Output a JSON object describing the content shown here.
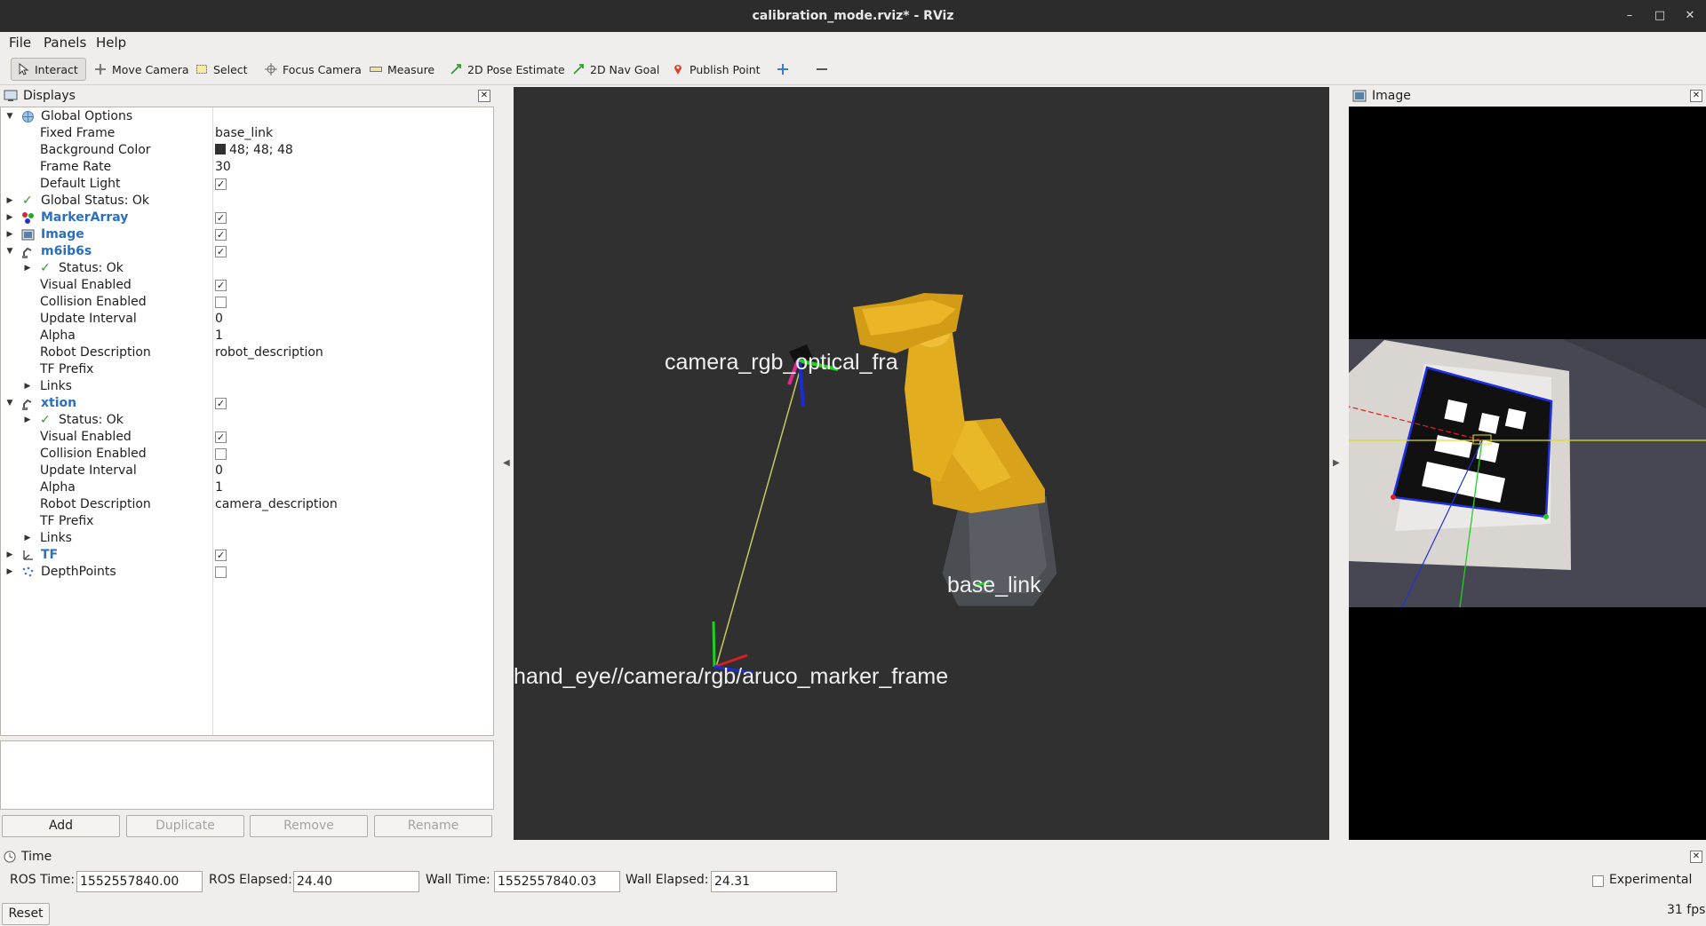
{
  "window": {
    "title": "calibration_mode.rviz* - RViz"
  },
  "menu": [
    "File",
    "Panels",
    "Help"
  ],
  "toolbar": {
    "interact": "Interact",
    "move_camera": "Move Camera",
    "select": "Select",
    "focus_camera": "Focus Camera",
    "measure": "Measure",
    "pose_estimate": "2D Pose Estimate",
    "nav_goal": "2D Nav Goal",
    "publish_point": "Publish Point"
  },
  "displays": {
    "title": "Displays",
    "global_options": "Global Options",
    "fixed_frame_label": "Fixed Frame",
    "fixed_frame": "base_link",
    "bg_color_label": "Background Color",
    "bg_color": "48; 48; 48",
    "frame_rate_label": "Frame Rate",
    "frame_rate": "30",
    "default_light_label": "Default Light",
    "global_status": "Global Status: Ok",
    "marker_array": "MarkerArray",
    "image": "Image",
    "robot1": {
      "name": "m6ib6s",
      "status": "Status: Ok",
      "visual_enabled": "Visual Enabled",
      "collision_enabled": "Collision Enabled",
      "update_interval_label": "Update Interval",
      "update_interval": "0",
      "alpha_label": "Alpha",
      "alpha": "1",
      "robot_desc_label": "Robot Description",
      "robot_desc": "robot_description",
      "tf_prefix": "TF Prefix",
      "links": "Links"
    },
    "robot2": {
      "name": "xtion",
      "status": "Status: Ok",
      "visual_enabled": "Visual Enabled",
      "collision_enabled": "Collision Enabled",
      "update_interval_label": "Update Interval",
      "update_interval": "0",
      "alpha_label": "Alpha",
      "alpha": "1",
      "robot_desc_label": "Robot Description",
      "robot_desc": "camera_description",
      "tf_prefix": "TF Prefix",
      "links": "Links"
    },
    "tf": "TF",
    "depth_points": "DepthPoints"
  },
  "buttons": {
    "add": "Add",
    "duplicate": "Duplicate",
    "remove": "Remove",
    "rename": "Rename"
  },
  "view3d": {
    "labels": {
      "camera": "camera_rgb_optical_fra",
      "base": "base_link",
      "marker": "hand_eye//camera/rgb/aruco_marker_frame"
    }
  },
  "image_panel": {
    "title": "Image"
  },
  "time": {
    "title": "Time",
    "ros_time_label": "ROS Time:",
    "ros_time": "1552557840.00",
    "ros_elapsed_label": "ROS Elapsed:",
    "ros_elapsed": "24.40",
    "wall_time_label": "Wall Time:",
    "wall_time": "1552557840.03",
    "wall_elapsed_label": "Wall Elapsed:",
    "wall_elapsed": "24.31",
    "experimental": "Experimental",
    "reset": "Reset",
    "fps": "31 fps"
  },
  "colors": {
    "accent_blue": "#2a6fc1",
    "view_bg": "#303030",
    "title_bg": "#2c2c2c",
    "robot_yellow": "#e6b422"
  }
}
